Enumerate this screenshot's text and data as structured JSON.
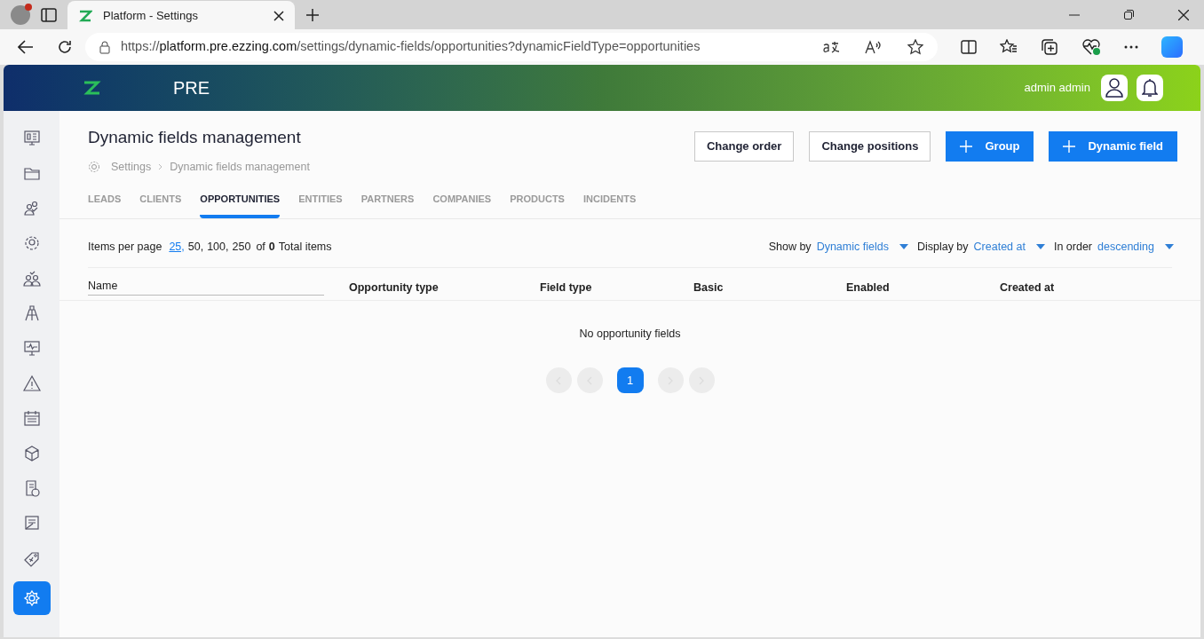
{
  "browser": {
    "tab_title": "Platform - Settings",
    "url": "https://platform.pre.ezzing.com/settings/dynamic-fields/opportunities?dynamicFieldType=opportunities"
  },
  "header": {
    "env": "PRE",
    "user": "admin admin"
  },
  "sidebar": {
    "items": [
      {
        "selected": false
      },
      {
        "selected": false
      },
      {
        "selected": false
      },
      {
        "selected": false
      },
      {
        "selected": false
      },
      {
        "selected": false
      },
      {
        "selected": false
      },
      {
        "selected": false
      },
      {
        "selected": false
      },
      {
        "selected": false
      },
      {
        "selected": false
      },
      {
        "selected": false
      },
      {
        "selected": false
      },
      {
        "selected": true
      }
    ]
  },
  "page": {
    "title": "Dynamic fields management",
    "breadcrumb": [
      "Settings",
      "Dynamic fields management"
    ]
  },
  "buttons": [
    {
      "label": "Change order",
      "kind": "outline"
    },
    {
      "label": "Change positions",
      "kind": "outline"
    },
    {
      "label": "Group",
      "kind": "add"
    },
    {
      "label": "Dynamic field",
      "kind": "add"
    }
  ],
  "tabs": [
    {
      "label": "LEADS",
      "selected": false
    },
    {
      "label": "CLIENTS",
      "selected": false
    },
    {
      "label": "OPPORTUNITIES",
      "selected": true
    },
    {
      "label": "ENTITIES",
      "selected": false
    },
    {
      "label": "PARTNERS",
      "selected": false
    },
    {
      "label": "COMPANIES",
      "selected": false
    },
    {
      "label": "PRODUCTS",
      "selected": false
    },
    {
      "label": "INCIDENTS",
      "selected": false
    }
  ],
  "items_per_page": {
    "label": "Items per page",
    "options": [
      {
        "label": "25,",
        "selected": true
      },
      {
        "label": "50,",
        "selected": false
      },
      {
        "label": "100,",
        "selected": false
      },
      {
        "label": "250",
        "selected": false
      }
    ],
    "of": "of",
    "total": "0",
    "total_label": "Total items"
  },
  "sorters": [
    {
      "label": "Show by",
      "value": "Dynamic fields"
    },
    {
      "label": "Display by",
      "value": "Created at"
    },
    {
      "label": "In order",
      "value": "descending"
    }
  ],
  "table": {
    "columns": [
      "Name",
      "Opportunity type",
      "Field type",
      "Basic",
      "Enabled",
      "Created at"
    ],
    "empty": "No opportunity fields"
  },
  "pagination": {
    "pages": [
      {
        "label": "1",
        "selected": true
      }
    ]
  }
}
